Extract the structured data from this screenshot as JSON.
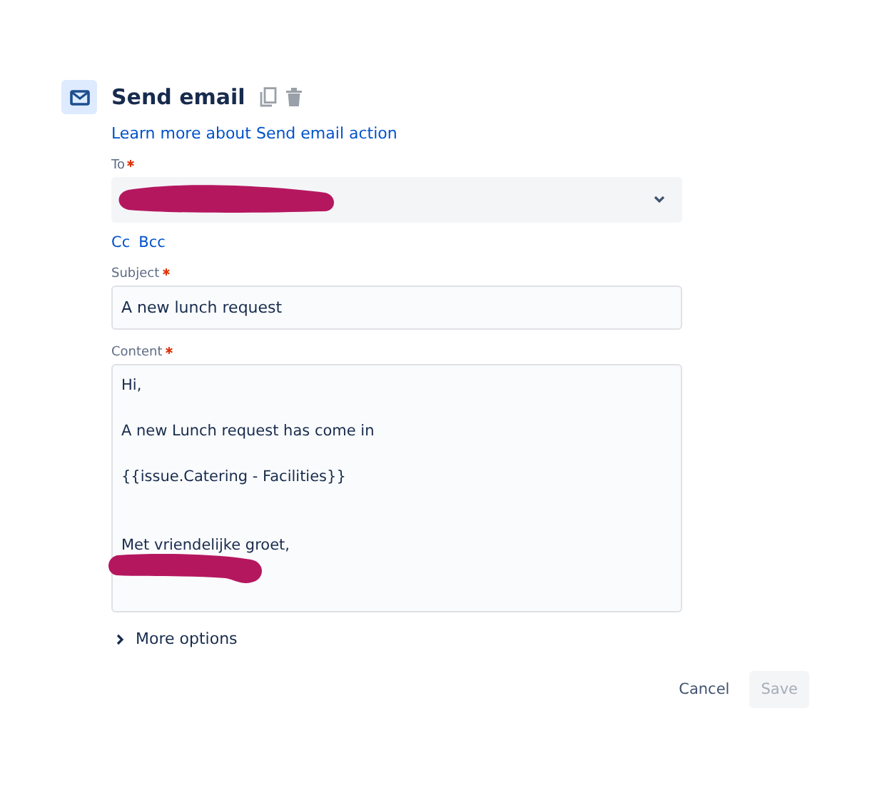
{
  "header": {
    "title": "Send email",
    "link": "Learn more about Send email action"
  },
  "fields": [
    {
      "kind": "select",
      "label": "To",
      "required": true,
      "redacted": true
    },
    {
      "kind": "links",
      "links": [
        "Cc",
        "Bcc"
      ]
    },
    {
      "kind": "text",
      "label": "Subject",
      "required": true,
      "value": "A new lunch request"
    },
    {
      "kind": "textarea",
      "label": "Content",
      "required": true,
      "value": "Hi,\n\nA new Lunch request has come in\n\n{{issue.Catering - Facilities}}\n\n\nMet vriendelijke groet,",
      "redacted": true
    }
  ],
  "more_options": {
    "label": "More options",
    "expanded": false
  },
  "buttons": [
    {
      "label": "Cancel",
      "kind": "subtle",
      "disabled": false
    },
    {
      "label": "Save",
      "kind": "primary",
      "disabled": true
    }
  ]
}
